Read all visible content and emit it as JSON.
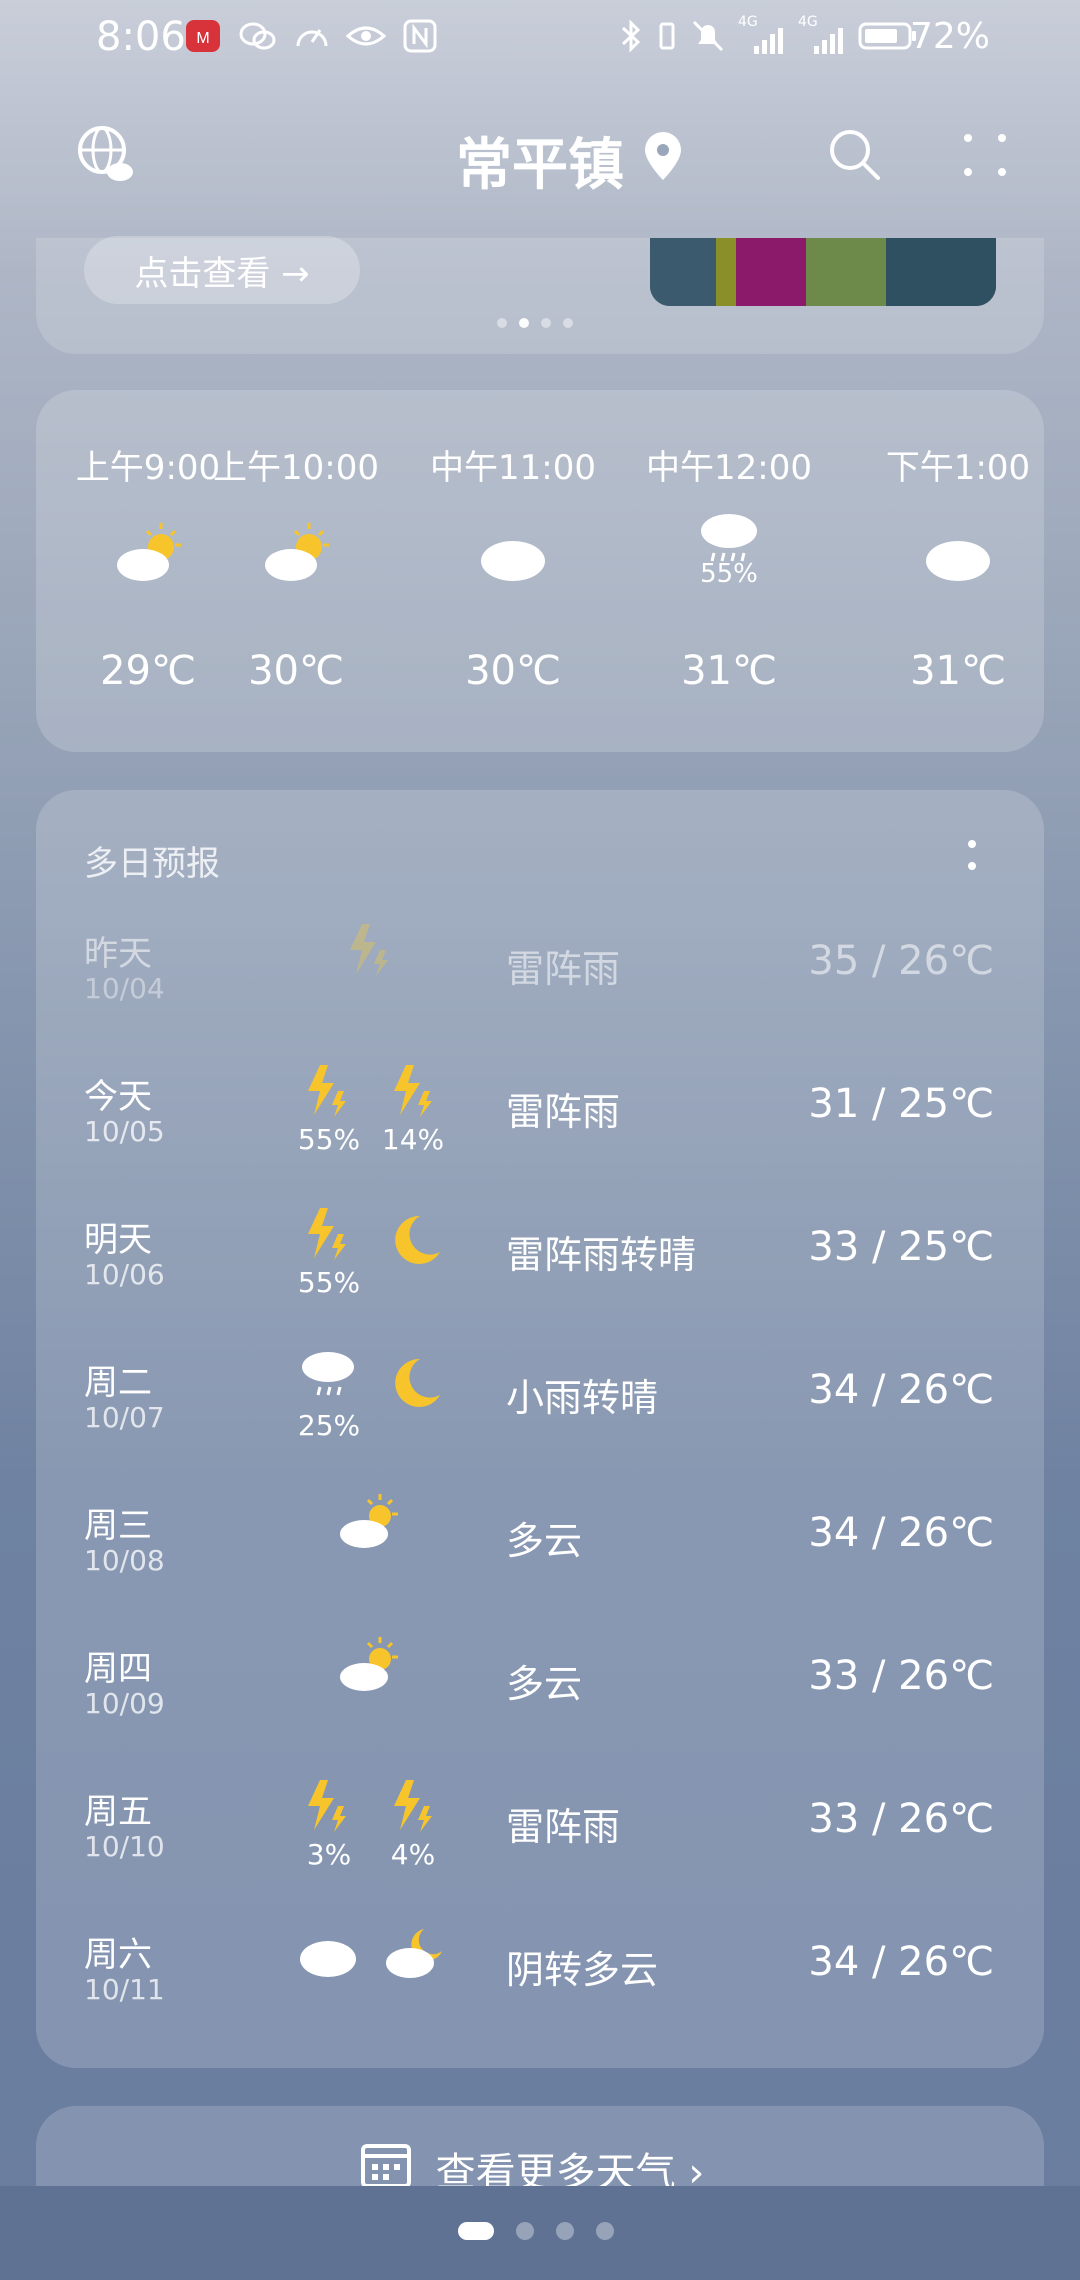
{
  "status": {
    "time": "8:06",
    "battery": "72%",
    "network_badges": [
      "4G",
      "4G"
    ]
  },
  "header": {
    "city": "常平镇",
    "icons": [
      "globe-cloud-icon",
      "location-pin-icon",
      "search-icon",
      "more-icon"
    ]
  },
  "banner": {
    "view_button": "点击查看 →",
    "dot_count": 4,
    "active_dot": 1
  },
  "hourly": [
    {
      "time": "上午9:00",
      "icon": "partly-sunny-icon",
      "precip": "",
      "temp": "29℃"
    },
    {
      "time": "上午10:00",
      "icon": "partly-sunny-icon",
      "precip": "",
      "temp": "30℃"
    },
    {
      "time": "中午11:00",
      "icon": "cloudy-icon",
      "precip": "",
      "temp": "30℃"
    },
    {
      "time": "中午12:00",
      "icon": "rain-icon",
      "precip": "55%",
      "temp": "31℃"
    },
    {
      "time": "下午1:00",
      "icon": "cloudy-icon",
      "precip": "",
      "temp": "31℃"
    }
  ],
  "daily": {
    "title": "多日预报",
    "rows": [
      {
        "day": "昨天",
        "date": "10/04",
        "desc": "雷阵雨",
        "temp": "35 / 26℃",
        "day_icon": "thunder-icon",
        "day_pct": "",
        "night_icon": "",
        "night_pct": ""
      },
      {
        "day": "今天",
        "date": "10/05",
        "desc": "雷阵雨",
        "temp": "31 / 25℃",
        "day_icon": "thunder-icon",
        "day_pct": "55%",
        "night_icon": "thunder-icon",
        "night_pct": "14%"
      },
      {
        "day": "明天",
        "date": "10/06",
        "desc": "雷阵雨转晴",
        "temp": "33 / 25℃",
        "day_icon": "thunder-icon",
        "day_pct": "55%",
        "night_icon": "moon-icon",
        "night_pct": ""
      },
      {
        "day": "周二",
        "date": "10/07",
        "desc": "小雨转晴",
        "temp": "34 / 26℃",
        "day_icon": "rain-icon",
        "day_pct": "25%",
        "night_icon": "moon-icon",
        "night_pct": ""
      },
      {
        "day": "周三",
        "date": "10/08",
        "desc": "多云",
        "temp": "34 / 26℃",
        "day_icon": "partly-sunny-icon",
        "day_pct": "",
        "night_icon": "",
        "night_pct": ""
      },
      {
        "day": "周四",
        "date": "10/09",
        "desc": "多云",
        "temp": "33 / 26℃",
        "day_icon": "partly-sunny-icon",
        "day_pct": "",
        "night_icon": "",
        "night_pct": ""
      },
      {
        "day": "周五",
        "date": "10/10",
        "desc": "雷阵雨",
        "temp": "33 / 26℃",
        "day_icon": "thunder-icon",
        "day_pct": "3%",
        "night_icon": "thunder-icon",
        "night_pct": "4%"
      },
      {
        "day": "周六",
        "date": "10/11",
        "desc": "阴转多云",
        "temp": "34 / 26℃",
        "day_icon": "cloudy-icon",
        "day_pct": "",
        "night_icon": "cloudy-moon-icon",
        "night_pct": ""
      }
    ]
  },
  "footer": {
    "more_weather": "查看更多天气 ›",
    "page_count": 4,
    "active_page": 0
  },
  "colors": {
    "sun": "#f7c52b",
    "cloud": "#ffffff",
    "thunder": "#f7c52b"
  }
}
